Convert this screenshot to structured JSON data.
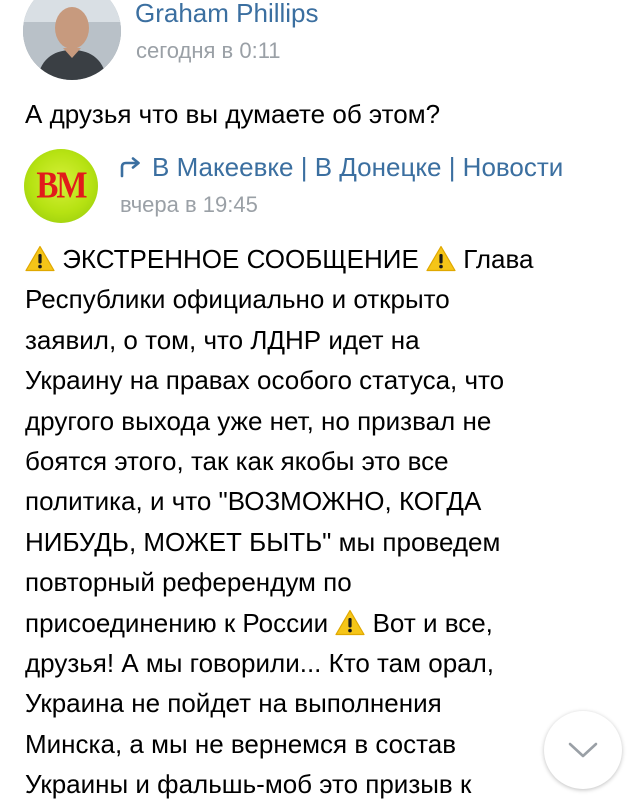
{
  "post": {
    "author_name": "Graham Phillips",
    "time": "сегодня в 0:11",
    "text": "А друзья что вы думаете об этом?"
  },
  "repost": {
    "avatar_logo": "ВМ",
    "source_name": "В Макеевке | В Донецке | Новости",
    "time": "вчера в 19:45",
    "lines": [
      {
        "pre_icon": true,
        "text": " ЭКСТРЕННОЕ СООБЩЕНИЕ ",
        "mid_icon": true,
        "tail": " Глава"
      },
      {
        "text": "Республики официально и открыто"
      },
      {
        "text": "заявил, о том, что ЛДНР идет на"
      },
      {
        "text": "Украину на правах особого статуса, что"
      },
      {
        "text": "другого выхода уже нет, но призвал не"
      },
      {
        "text": "боятся этого, так как якобы это все"
      },
      {
        "text": "политика, и что \"ВОЗМОЖНО, КОГДА"
      },
      {
        "text": "НИБУДЬ, МОЖЕТ БЫТЬ\" мы проведем"
      },
      {
        "text": "повторный референдум по"
      },
      {
        "text": "присоединению к России ",
        "mid_icon": true,
        "tail": " Вот и все,"
      },
      {
        "text": "друзья! А мы говорили... Кто там орал,"
      },
      {
        "text": "Украина не пойдет на выполнения"
      },
      {
        "text": "Минска, а мы не вернемся в состав"
      },
      {
        "text": "Украины и фальшь-моб это призыв к"
      }
    ]
  },
  "icons": {
    "warning": "warning-icon",
    "repost": "repost-arrow-icon",
    "scroll": "chevron-down-icon"
  },
  "colors": {
    "link": "#3b6fa0",
    "meta": "#9aa0a6",
    "warning_fill": "#f5c518",
    "logo_green": "#b6e212",
    "logo_red": "#e11b1b"
  }
}
